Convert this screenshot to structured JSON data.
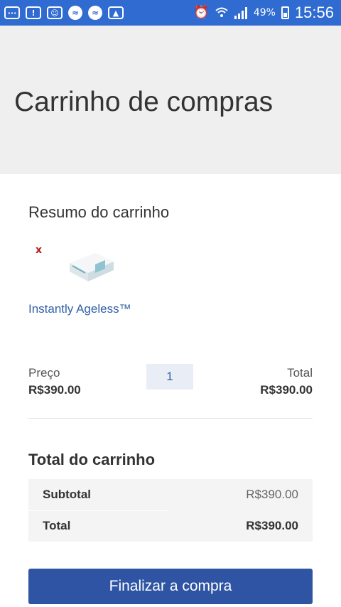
{
  "status_bar": {
    "battery_percent": "49%",
    "time": "15:56",
    "notification_icons": [
      "more-icon",
      "alert-icon",
      "face-icon",
      "messenger-icon",
      "messenger-icon",
      "image-icon"
    ],
    "status_icons": [
      "alarm-icon",
      "wifi-icon",
      "signal-icon",
      "battery-icon"
    ]
  },
  "header": {
    "title": "Carrinho de compras"
  },
  "summary": {
    "heading": "Resumo do carrinho",
    "remove_symbol": "x",
    "product_name": "Instantly Ageless™",
    "price_label": "Preço",
    "price_value": "R$390.00",
    "quantity": "1",
    "total_label": "Total",
    "total_value": "R$390.00"
  },
  "totals": {
    "heading": "Total do carrinho",
    "rows": [
      {
        "label": "Subtotal",
        "value": "R$390.00"
      },
      {
        "label": "Total",
        "value": "R$390.00"
      }
    ]
  },
  "checkout": {
    "label": "Finalizar a compra"
  },
  "colors": {
    "status_bar": "#2f6bd1",
    "header_bg": "#efefef",
    "link": "#2f5fa8",
    "remove": "#b31b1b",
    "button": "#2e54a3"
  }
}
